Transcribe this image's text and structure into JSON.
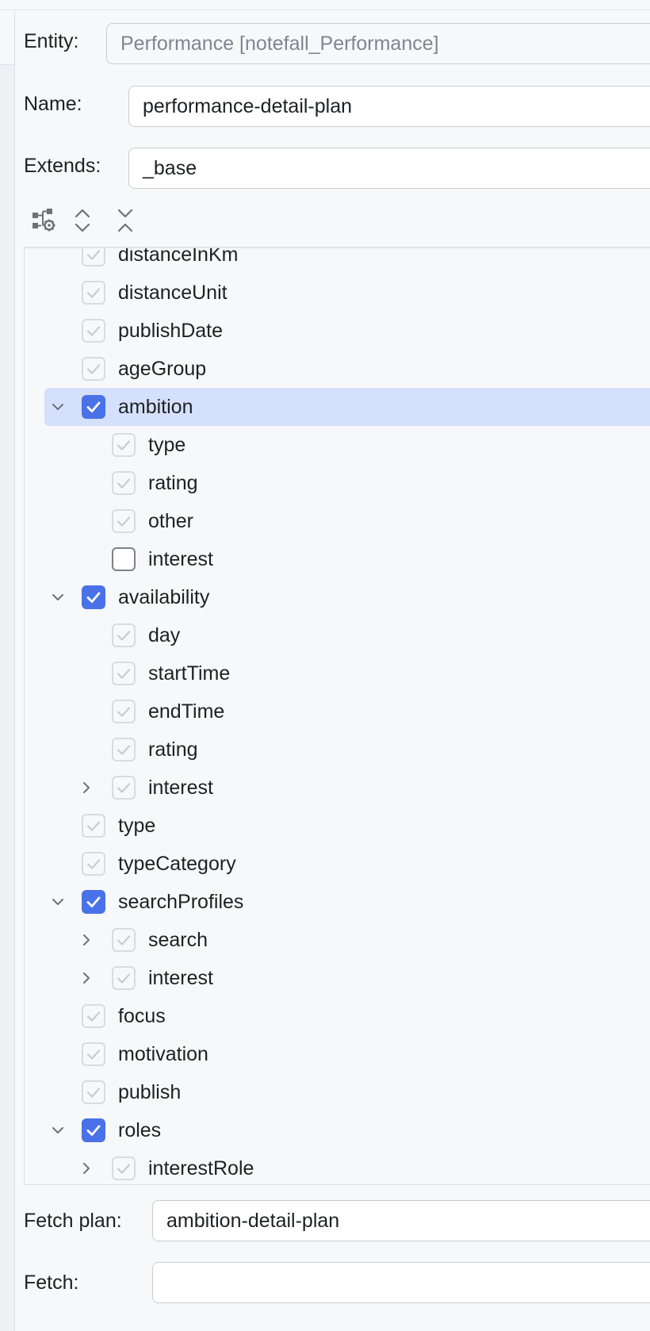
{
  "form": {
    "entity_label": "Entity:",
    "entity_value": "Performance [notefall_Performance]",
    "name_label": "Name:",
    "name_value": "performance-detail-plan",
    "extends_label": "Extends:",
    "extends_value": "_base",
    "fetch_plan_label": "Fetch plan:",
    "fetch_plan_value": "ambition-detail-plan",
    "fetch_label": "Fetch:",
    "fetch_value": ""
  },
  "toolbar": {
    "icons": [
      "hierarchy-settings-icon",
      "expand-all-icon",
      "collapse-all-icon"
    ]
  },
  "tree": {
    "nodes": [
      {
        "label": "distanceInKm",
        "level": 1,
        "state": "dim",
        "expander": "none"
      },
      {
        "label": "distanceUnit",
        "level": 1,
        "state": "dim",
        "expander": "none"
      },
      {
        "label": "publishDate",
        "level": 1,
        "state": "dim",
        "expander": "none"
      },
      {
        "label": "ageGroup",
        "level": 1,
        "state": "dim",
        "expander": "none"
      },
      {
        "label": "ambition",
        "level": 1,
        "state": "checked",
        "expander": "expanded",
        "selected": true
      },
      {
        "label": "type",
        "level": 2,
        "state": "dim",
        "expander": "none"
      },
      {
        "label": "rating",
        "level": 2,
        "state": "dim",
        "expander": "none"
      },
      {
        "label": "other",
        "level": 2,
        "state": "dim",
        "expander": "none"
      },
      {
        "label": "interest",
        "level": 2,
        "state": "unchecked",
        "expander": "none"
      },
      {
        "label": "availability",
        "level": 1,
        "state": "checked",
        "expander": "expanded"
      },
      {
        "label": "day",
        "level": 2,
        "state": "dim",
        "expander": "none"
      },
      {
        "label": "startTime",
        "level": 2,
        "state": "dim",
        "expander": "none"
      },
      {
        "label": "endTime",
        "level": 2,
        "state": "dim",
        "expander": "none"
      },
      {
        "label": "rating",
        "level": 2,
        "state": "dim",
        "expander": "none"
      },
      {
        "label": "interest",
        "level": 2,
        "state": "dim",
        "expander": "collapsed"
      },
      {
        "label": "type",
        "level": 1,
        "state": "dim",
        "expander": "none"
      },
      {
        "label": "typeCategory",
        "level": 1,
        "state": "dim",
        "expander": "none"
      },
      {
        "label": "searchProfiles",
        "level": 1,
        "state": "checked",
        "expander": "expanded"
      },
      {
        "label": "search",
        "level": 2,
        "state": "dim",
        "expander": "collapsed"
      },
      {
        "label": "interest",
        "level": 2,
        "state": "dim",
        "expander": "collapsed"
      },
      {
        "label": "focus",
        "level": 1,
        "state": "dim",
        "expander": "none"
      },
      {
        "label": "motivation",
        "level": 1,
        "state": "dim",
        "expander": "none"
      },
      {
        "label": "publish",
        "level": 1,
        "state": "dim",
        "expander": "none"
      },
      {
        "label": "roles",
        "level": 1,
        "state": "checked",
        "expander": "expanded"
      },
      {
        "label": "interestRole",
        "level": 2,
        "state": "dim",
        "expander": "collapsed"
      }
    ]
  },
  "colors": {
    "accent": "#4a72e8",
    "selection": "#d4e0fc",
    "background": "#f7f8fa"
  }
}
